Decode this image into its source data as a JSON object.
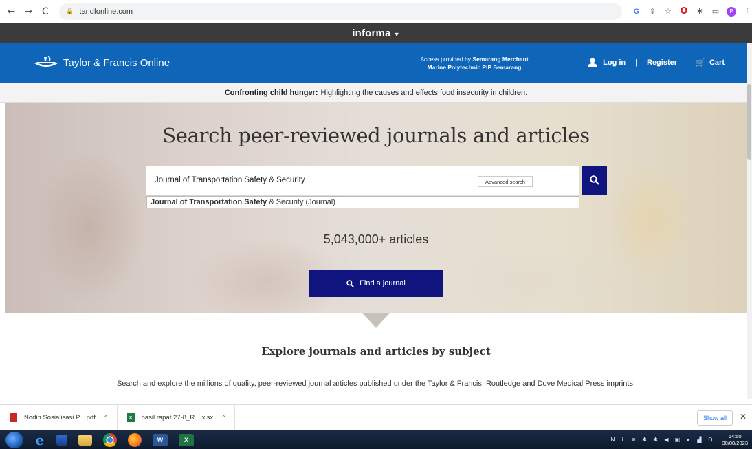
{
  "browser": {
    "url": "tandfonline.com",
    "nav": {
      "back": "←",
      "forward": "→",
      "reload": "C"
    },
    "extensions": [
      "google-icon",
      "share-icon",
      "star-icon",
      "opera-icon",
      "puzzle-icon",
      "sidebar-icon",
      "profile-avatar"
    ],
    "profile_initial": "P"
  },
  "informa": {
    "label": "informa"
  },
  "header": {
    "logo_text": "Taylor & Francis Online",
    "access_prefix": "Access provided by",
    "access_org_line1": "Semarang Merchant",
    "access_org_line2": "Marine Polytechnic PIP Semarang",
    "login": "Log in",
    "register": "Register",
    "cart": "Cart"
  },
  "announcement": {
    "bold": "Confronting child hunger:",
    "text": "Highlighting the causes and effects food insecurity in children."
  },
  "hero": {
    "title": "Search peer-reviewed journals and articles",
    "search_value": "Journal of Transportation Safety & Security",
    "advanced_search": "Advanced search",
    "suggestion_bold": "Journal of Transportation Safety",
    "suggestion_rest": "& Security (Journal)",
    "article_count": "5,043,000+ articles",
    "find_journal": "Find a journal"
  },
  "explore": {
    "title": "Explore journals and articles by subject",
    "subtitle": "Search and explore the millions of quality, peer-reviewed journal articles published under the Taylor & Francis, Routledge and Dove Medical Press imprints."
  },
  "downloads": {
    "items": [
      {
        "name": "Nodin Sosialisasi P....pdf",
        "type": "pdf"
      },
      {
        "name": "hasil rapat 27-8_R....xlsx",
        "type": "xlsx"
      }
    ],
    "show_all": "Show all"
  },
  "taskbar": {
    "lang": "IN",
    "time": "14:50",
    "date": "30/08/2023"
  },
  "colors": {
    "header_blue": "#0f66b8",
    "navy": "#10147e",
    "informa_bar": "#3b3b3b"
  }
}
